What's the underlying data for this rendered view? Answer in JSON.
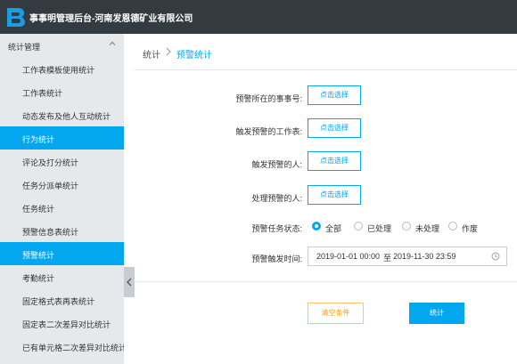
{
  "app": {
    "title": "事事明管理后台-河南发恩德矿业有限公司"
  },
  "sidebar": {
    "group_label": "统计管理",
    "items": [
      {
        "label": "工作表模板使用统计"
      },
      {
        "label": "工作表统计"
      },
      {
        "label": "动态发布及他人互动统计"
      },
      {
        "label": "行为统计"
      },
      {
        "label": "评论及打分统计"
      },
      {
        "label": "任务分派单统计"
      },
      {
        "label": "任务统计"
      },
      {
        "label": "预警信息表统计"
      },
      {
        "label": "预警统计"
      },
      {
        "label": "考勤统计"
      },
      {
        "label": "固定格式表再表统计"
      },
      {
        "label": "固定表二次差异对比统计"
      },
      {
        "label": "已有单元格二次差异对比统计"
      }
    ]
  },
  "breadcrumb": {
    "root": "统计",
    "current": "预警统计"
  },
  "form": {
    "affair_label": "预警所在的事事号:",
    "sheet_label": "触发预警的工作表:",
    "trigger_person_label": "触发预警的人:",
    "handler_label": "处理预警的人:",
    "select_button": "点击选择",
    "status_label": "预警任务状态:",
    "status_options": [
      "全部",
      "已处理",
      "未处理",
      "作废"
    ],
    "status_selected": "全部",
    "time_label": "预警触发时间:",
    "date_start": "2019-01-01 00:00",
    "date_sep": "至",
    "date_end": "2019-11-30 23:59"
  },
  "actions": {
    "clear": "清空条件",
    "submit": "统计"
  },
  "colors": {
    "accent": "#02a7f0",
    "topbar": "#333b40",
    "sidebar_bg": "#e6e9ec",
    "clear_text": "#ff9d00"
  }
}
